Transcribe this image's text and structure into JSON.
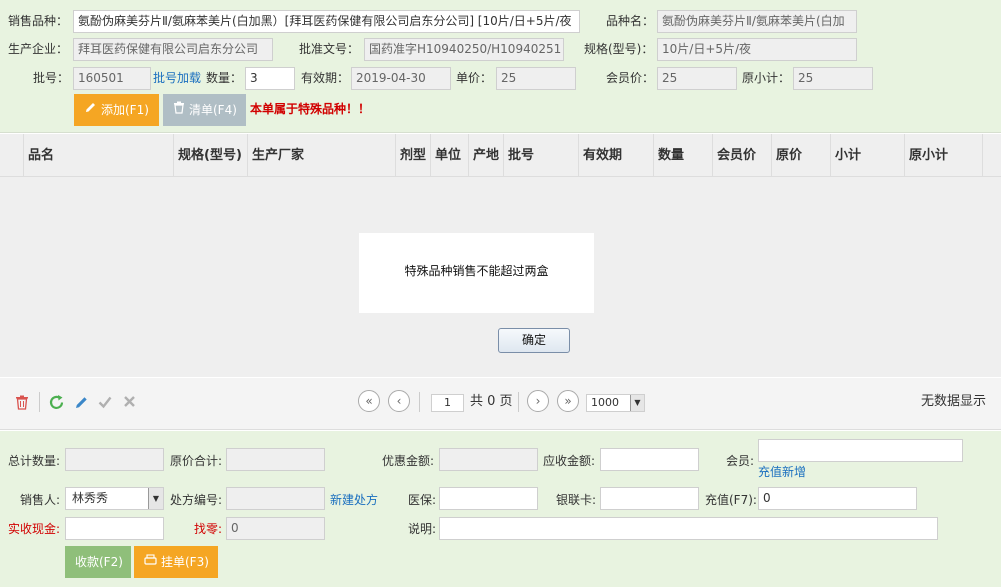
{
  "form": {
    "product_label": "销售品种：",
    "product_value": "氨酚伪麻美芬片Ⅱ/氨麻苯美片(白加黑）[拜耳医药保健有限公司启东分公司] [10片/日+5片/夜",
    "name_label": "品种名：",
    "name_value": "氨酚伪麻美芬片Ⅱ/氨麻苯美片(白加",
    "maker_label": "生产企业：",
    "maker_value": "拜耳医药保健有限公司启东分公司",
    "approval_label": "批准文号：",
    "approval_value": "国药准字H10940250/H10940251",
    "spec_label": "规格(型号)：",
    "spec_value": "10片/日+5片/夜",
    "batch_label": "批号：",
    "batch_value": "160501",
    "batch_add_link": "批号加载",
    "qty_label": "数量：",
    "qty_value": "3",
    "expiry_label": "有效期：",
    "expiry_value": "2019-04-30",
    "price_label": "单价：",
    "price_value": "25",
    "member_price_label": "会员价：",
    "member_price_value": "25",
    "orig_subtotal_label": "原小计：",
    "orig_subtotal_value": "25",
    "add_button": "添加(F1)",
    "clear_button": "清单(F4)",
    "special_warning": "本单属于特殊品种！！"
  },
  "table": {
    "columns": [
      "品名",
      "规格(型号)",
      "生产厂家",
      "剂型",
      "单位",
      "产地",
      "批号",
      "有效期",
      "数量",
      "会员价",
      "原价",
      "小计",
      "原小计"
    ]
  },
  "dialog": {
    "message": "特殊品种销售不能超过两盒",
    "ok_button": "确定"
  },
  "pager": {
    "page_value": "1",
    "total_pages_text": "共 0 页",
    "page_size": "1000",
    "no_data": "无数据显示"
  },
  "summary": {
    "total_qty_label": "总计数量:",
    "orig_total_label": "原价合计:",
    "discount_label": "优惠金额:",
    "receivable_label": "应收金额:",
    "member_label": "会员:",
    "recharge_new_link": "充值新增",
    "seller_label": "销售人:",
    "seller_value": "林秀秀",
    "prescription_label": "处方编号:",
    "new_prescription_link": "新建处方",
    "medical_insurance_label": "医保:",
    "unionpay_label": "银联卡:",
    "recharge_label": "充值(F7):",
    "recharge_value": "0",
    "cash_label": "实收现金:",
    "change_label": "找零:",
    "change_value": "0",
    "note_label": "说明:",
    "collect_button": "收款(F2)",
    "hold_button": "挂单(F3)"
  },
  "colors": {
    "panel_green": "#e8f3e0",
    "accent_orange": "#f5a623",
    "link_blue": "#1a6fbf",
    "warning_red": "#d10000"
  }
}
